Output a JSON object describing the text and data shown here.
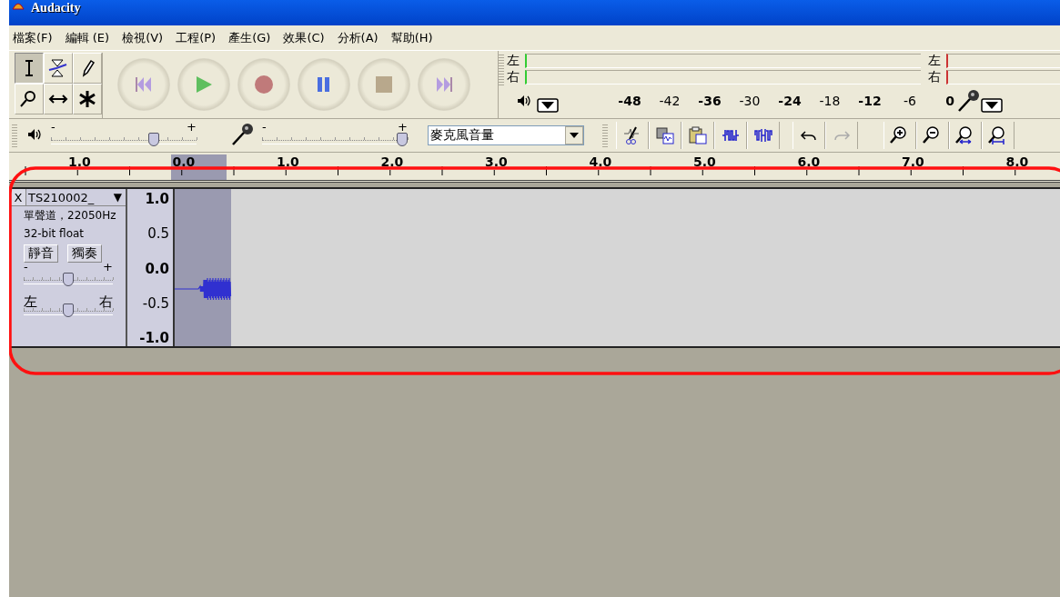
{
  "window": {
    "title": "Audacity"
  },
  "menu": [
    {
      "label": "檔案(F)"
    },
    {
      "label": "編輯 (E)"
    },
    {
      "label": "檢視(V)"
    },
    {
      "label": "工程(P)"
    },
    {
      "label": "產生(G)"
    },
    {
      "label": "效果(C)"
    },
    {
      "label": "分析(A)"
    },
    {
      "label": "幫助(H)"
    }
  ],
  "tools": [
    {
      "kind": "select",
      "selected": true
    },
    {
      "kind": "envelope",
      "selected": false
    },
    {
      "kind": "draw",
      "selected": false
    },
    {
      "kind": "zoom",
      "selected": false
    },
    {
      "kind": "timeshift",
      "selected": false
    },
    {
      "kind": "multi",
      "selected": false
    }
  ],
  "transport": [
    {
      "kind": "skip-start"
    },
    {
      "kind": "play"
    },
    {
      "kind": "record"
    },
    {
      "kind": "pause"
    },
    {
      "kind": "stop"
    },
    {
      "kind": "skip-end"
    }
  ],
  "meters": {
    "output": {
      "channels": [
        "左",
        "右"
      ],
      "scale": [
        "-48",
        "-42",
        "-36",
        "-30",
        "-24",
        "-18",
        "-12",
        "-6",
        "0"
      ]
    },
    "input": {
      "channels": [
        "左",
        "右"
      ]
    }
  },
  "mixer": {
    "output_volume": {
      "min_label": "-",
      "max_label": "+",
      "level": 0.72
    },
    "input_volume": {
      "min_label": "-",
      "max_label": "+",
      "level": 1.0
    },
    "input_source": "麥克風音量"
  },
  "history": [
    {
      "kind": "undo",
      "disabled": false
    },
    {
      "kind": "redo",
      "disabled": true
    }
  ],
  "ruler": {
    "labels": [
      "1.0",
      "0.0",
      "1.0",
      "2.0",
      "3.0",
      "4.0",
      "5.0",
      "6.0",
      "7.0",
      "8.0"
    ]
  },
  "track": {
    "close": "X",
    "name": "TS210002_",
    "menu_arrow": "▼",
    "info": [
      "單聲道，22050Hz",
      "32-bit float"
    ],
    "mute": "靜音",
    "solo": "獨奏",
    "gain": {
      "min_label": "-",
      "max_label": "+",
      "level": 0.5
    },
    "pan": {
      "left_label": "左",
      "right_label": "右",
      "level": 0.5
    },
    "scale": [
      "1.0",
      "0.5",
      "0.0",
      "-0.5",
      "-1.0"
    ]
  }
}
